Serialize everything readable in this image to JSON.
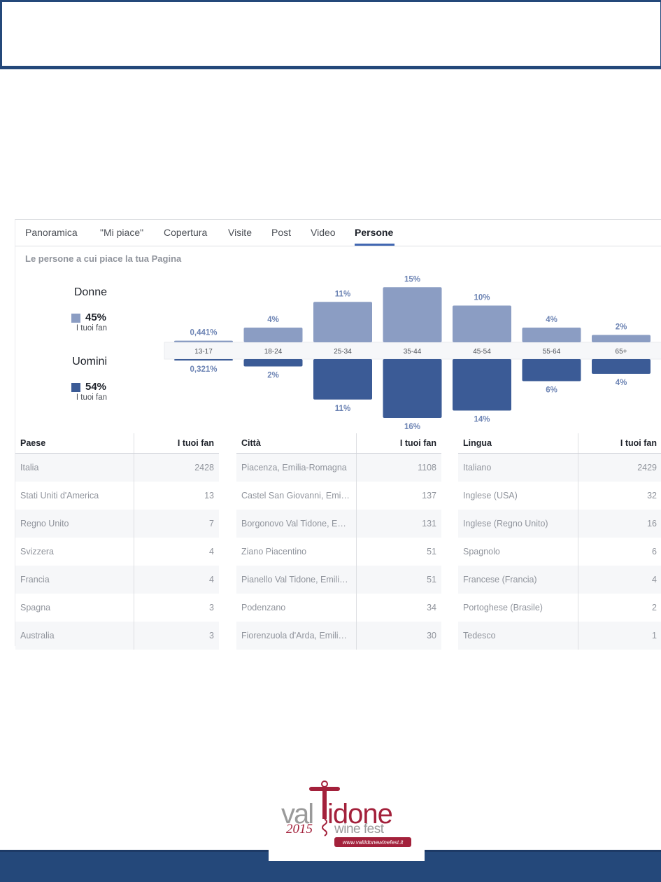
{
  "colors": {
    "women": "#8b9dc3",
    "men": "#3b5b96",
    "accent_tab": "#4267b2",
    "footer": "#24487a",
    "brand_red": "#a3213b",
    "brand_gray": "#9a9a9a"
  },
  "tabs": [
    {
      "label": "Panoramica",
      "active": false
    },
    {
      "label": "\"Mi piace\"",
      "active": false
    },
    {
      "label": "Copertura",
      "active": false
    },
    {
      "label": "Visite",
      "active": false
    },
    {
      "label": "Post",
      "active": false
    },
    {
      "label": "Video",
      "active": false
    },
    {
      "label": "Persone",
      "active": true
    }
  ],
  "section_title": "Le persone a cui piace la tua Pagina",
  "legend": {
    "women": {
      "title": "Donne",
      "pct": "45%",
      "sub": "I tuoi fan"
    },
    "men": {
      "title": "Uomini",
      "pct": "54%",
      "sub": "I tuoi fan"
    }
  },
  "chart_data": {
    "type": "bar",
    "categories": [
      "13-17",
      "18-24",
      "25-34",
      "35-44",
      "45-54",
      "55-64",
      "65+"
    ],
    "series": [
      {
        "name": "Donne",
        "values": [
          0.441,
          4,
          11,
          15,
          10,
          4,
          2
        ],
        "labels": [
          "0,441%",
          "4%",
          "11%",
          "15%",
          "10%",
          "4%",
          "2%"
        ]
      },
      {
        "name": "Uomini",
        "values": [
          0.321,
          2,
          11,
          16,
          14,
          6,
          4
        ],
        "labels": [
          "0,321%",
          "2%",
          "11%",
          "16%",
          "14%",
          "6%",
          "4%"
        ]
      }
    ],
    "ylim": [
      0,
      16
    ]
  },
  "tables": [
    {
      "header": [
        "Paese",
        "I tuoi fan"
      ],
      "rows": [
        [
          "Italia",
          "2428"
        ],
        [
          "Stati Uniti d'America",
          "13"
        ],
        [
          "Regno Unito",
          "7"
        ],
        [
          "Svizzera",
          "4"
        ],
        [
          "Francia",
          "4"
        ],
        [
          "Spagna",
          "3"
        ],
        [
          "Australia",
          "3"
        ]
      ]
    },
    {
      "header": [
        "Città",
        "I tuoi fan"
      ],
      "rows": [
        [
          "Piacenza, Emilia-Romagna",
          "1108"
        ],
        [
          "Castel San Giovanni, Emi…",
          "137"
        ],
        [
          "Borgonovo Val Tidone, E…",
          "131"
        ],
        [
          "Ziano Piacentino",
          "51"
        ],
        [
          "Pianello Val Tidone, Emili…",
          "51"
        ],
        [
          "Podenzano",
          "34"
        ],
        [
          "Fiorenzuola d'Arda, Emili…",
          "30"
        ]
      ]
    },
    {
      "header": [
        "Lingua",
        "I tuoi fan"
      ],
      "rows": [
        [
          "Italiano",
          "2429"
        ],
        [
          "Inglese (USA)",
          "32"
        ],
        [
          "Inglese (Regno Unito)",
          "16"
        ],
        [
          "Spagnolo",
          "6"
        ],
        [
          "Francese (Francia)",
          "4"
        ],
        [
          "Portoghese (Brasile)",
          "2"
        ],
        [
          "Tedesco",
          "1"
        ]
      ]
    }
  ],
  "logo": {
    "word_val": "val",
    "word_tidone": "idone",
    "year": "2015",
    "wine_fest": "wine fest",
    "url": "www.valtidonewinefest.it"
  }
}
